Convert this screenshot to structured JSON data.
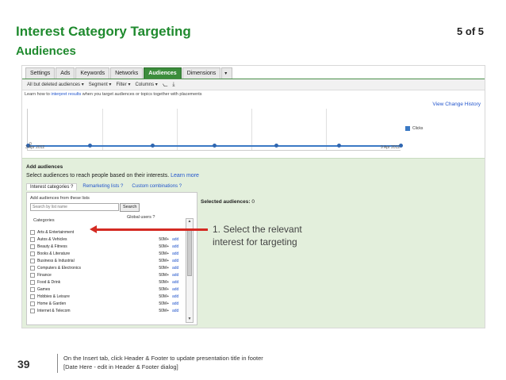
{
  "slide": {
    "title": "Interest Category Targeting",
    "subtitle": "Audiences",
    "page_count": "5 of 5",
    "page_number": "39",
    "footer_line1": "On the Insert tab, click Header & Footer to update presentation title in footer",
    "footer_line2": "[Date Here - edit in Header & Footer dialog]"
  },
  "tabs": [
    {
      "label": "Settings"
    },
    {
      "label": "Ads"
    },
    {
      "label": "Keywords"
    },
    {
      "label": "Networks"
    },
    {
      "label": "Audiences"
    },
    {
      "label": "Dimensions"
    }
  ],
  "toolbar": {
    "filter_all": "All but deleted audiences ▾",
    "segment": "Segment ▾",
    "filter": "Filter ▾",
    "columns": "Columns ▾"
  },
  "learn": {
    "prefix": "Learn how to",
    "link": "interpret results",
    "suffix": "when you target audiences or topics together with placements"
  },
  "view_change_history": "View Change History",
  "chart": {
    "y_tick": "0",
    "x_start": "3 Apr 2012",
    "x_end": "9 Apr 2012",
    "legend": "Clicks",
    "series_color": "#3b79c4"
  },
  "chart_data": {
    "type": "line",
    "x": [
      "3 Apr 2012",
      "4 Apr 2012",
      "5 Apr 2012",
      "6 Apr 2012",
      "7 Apr 2012",
      "8 Apr 2012",
      "9 Apr 2012"
    ],
    "series": [
      {
        "name": "Clicks",
        "values": [
          0,
          0,
          0,
          0,
          0,
          0,
          0
        ]
      }
    ]
  },
  "panel": {
    "heading": "Add audiences",
    "select_text": "Select audiences to reach people based on their interests.",
    "learn_more": "Learn more",
    "subtabs": [
      "Interest categories ?",
      "Remarketing lists ?",
      "Custom combinations ?"
    ],
    "selected_label": "Selected audiences:",
    "selected_count": "0",
    "add_from_lists": "Add audiences from these lists",
    "search_placeholder": "Search by list name",
    "search_button": "Search",
    "col_categories": "Categories",
    "col_global_users": "Global users ?"
  },
  "categories": [
    {
      "name": "Arts & Entertainment",
      "users": "",
      "add": ""
    },
    {
      "name": "Autos & Vehicles",
      "users": "50M+",
      "add": "add"
    },
    {
      "name": "Beauty & Fitness",
      "users": "50M+",
      "add": "add"
    },
    {
      "name": "Books & Literature",
      "users": "50M+",
      "add": "add"
    },
    {
      "name": "Business & Industrial",
      "users": "50M+",
      "add": "add"
    },
    {
      "name": "Computers & Electronics",
      "users": "50M+",
      "add": "add"
    },
    {
      "name": "Finance",
      "users": "50M+",
      "add": "add"
    },
    {
      "name": "Food & Drink",
      "users": "50M+",
      "add": "add"
    },
    {
      "name": "Games",
      "users": "50M+",
      "add": "add"
    },
    {
      "name": "Hobbies & Leisure",
      "users": "50M+",
      "add": "add"
    },
    {
      "name": "Home & Garden",
      "users": "50M+",
      "add": "add"
    },
    {
      "name": "Internet & Telecom",
      "users": "50M+",
      "add": "add"
    }
  ],
  "callout": "1. Select the relevant interest for targeting",
  "colors": {
    "title": "#1f8a2e",
    "arrow": "#d42a22",
    "panel": "#e3efdc",
    "active_tab": "#3c8d3c"
  }
}
